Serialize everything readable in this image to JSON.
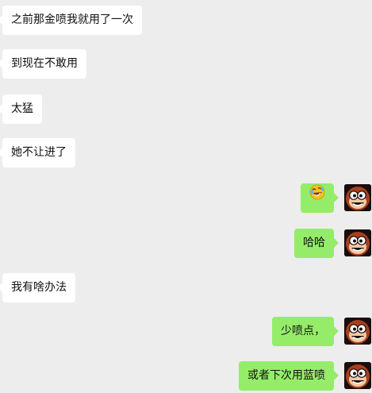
{
  "messages": [
    {
      "side": "in",
      "text": "之前那金喷我就用了一次"
    },
    {
      "side": "in",
      "text": "到现在不敢用"
    },
    {
      "side": "in",
      "text": "太猛"
    },
    {
      "side": "in",
      "text": "她不让进了"
    },
    {
      "side": "out",
      "text": "",
      "emoji": "rolling-on-floor-laughing-emoji"
    },
    {
      "side": "out",
      "text": "哈哈"
    },
    {
      "side": "in",
      "text": "我有啥办法"
    },
    {
      "side": "out",
      "text": "少喷点，"
    },
    {
      "side": "out",
      "text": "或者下次用蓝喷"
    }
  ],
  "colors": {
    "background": "#ededed",
    "incoming_bubble": "#ffffff",
    "outgoing_bubble": "#95ec69"
  },
  "avatar_icon": "cartoon-monkey-avatar-icon"
}
